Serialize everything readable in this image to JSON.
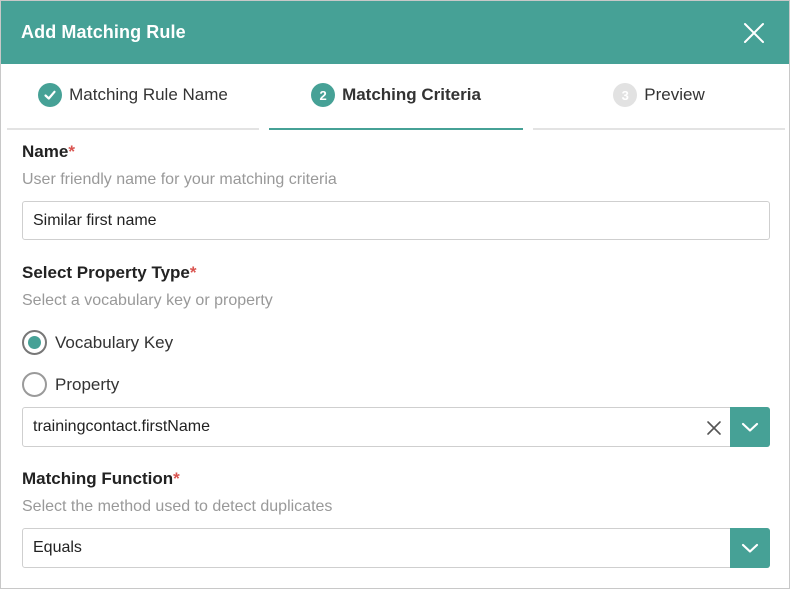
{
  "dialog": {
    "title": "Add Matching Rule",
    "close_icon": "close-icon"
  },
  "steps": [
    {
      "label": "Matching Rule Name",
      "badge": "",
      "state": "done",
      "icon": "check-icon"
    },
    {
      "label": "Matching Criteria",
      "badge": "2",
      "state": "active"
    },
    {
      "label": "Preview",
      "badge": "3",
      "state": "pending"
    }
  ],
  "name_field": {
    "label": "Name",
    "required_mark": "*",
    "help": "User friendly name for your matching criteria",
    "value": "Similar first name"
  },
  "property_type": {
    "label": "Select Property Type",
    "required_mark": "*",
    "help": "Select a vocabulary key or property",
    "options": [
      {
        "label": "Vocabulary Key",
        "checked": true
      },
      {
        "label": "Property",
        "checked": false
      }
    ],
    "selected_value": "trainingcontact.firstName"
  },
  "matching_function": {
    "label": "Matching Function",
    "required_mark": "*",
    "help": "Select the method used to detect duplicates",
    "selected_value": "Equals"
  },
  "colors": {
    "accent": "#46a196",
    "required": "#d9534f",
    "help_text": "#999999"
  }
}
